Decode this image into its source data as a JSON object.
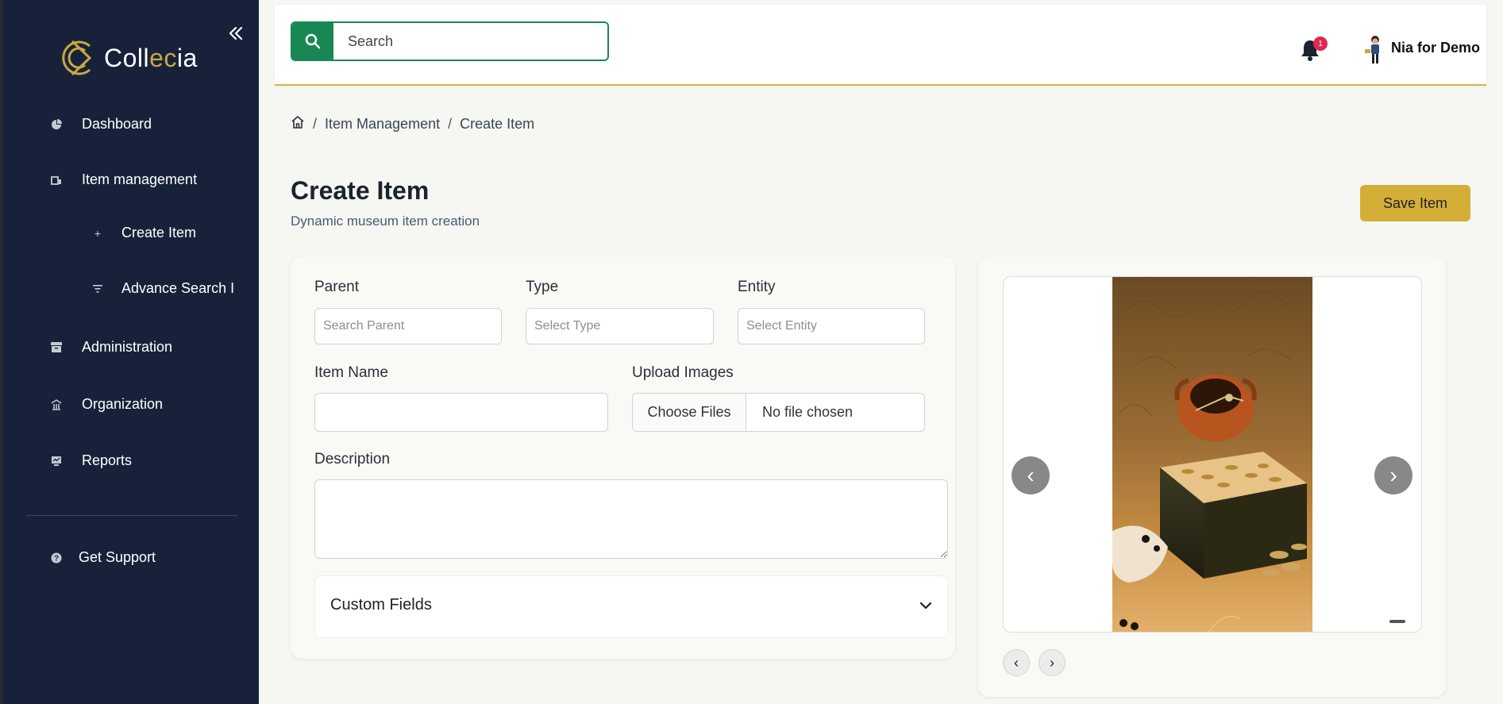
{
  "brand": {
    "name_prefix": "Coll",
    "name_gold": "ec",
    "name_suffix": "ia"
  },
  "sidebar": {
    "items": [
      {
        "label": "Dashboard",
        "icon": "pie-chart-icon"
      },
      {
        "label": "Item management",
        "icon": "items-icon"
      },
      {
        "label": "Create Item",
        "icon": "plus-icon"
      },
      {
        "label": "Advance Search I",
        "icon": "filter-icon"
      },
      {
        "label": "Administration",
        "icon": "archive-icon"
      },
      {
        "label": "Organization",
        "icon": "building-icon"
      },
      {
        "label": "Reports",
        "icon": "report-icon"
      }
    ],
    "support_label": "Get Support"
  },
  "header": {
    "search_placeholder": "Search",
    "notification_count": "1",
    "user_name": "Nia for Demo"
  },
  "breadcrumb": {
    "item1": "Item Management",
    "item2": "Create Item"
  },
  "page": {
    "title": "Create Item",
    "subtitle": "Dynamic museum item creation",
    "save_label": "Save Item"
  },
  "form": {
    "parent_label": "Parent",
    "parent_placeholder": "Search Parent",
    "type_label": "Type",
    "type_placeholder": "Select Type",
    "entity_label": "Entity",
    "entity_placeholder": "Select Entity",
    "item_name_label": "Item Name",
    "upload_label": "Upload Images",
    "choose_files": "Choose Files",
    "no_file": "No file chosen",
    "description_label": "Description",
    "custom_fields_label": "Custom Fields"
  },
  "colors": {
    "sidebar_bg": "#17223a",
    "accent_green": "#198754",
    "accent_gold": "#d4af37"
  }
}
